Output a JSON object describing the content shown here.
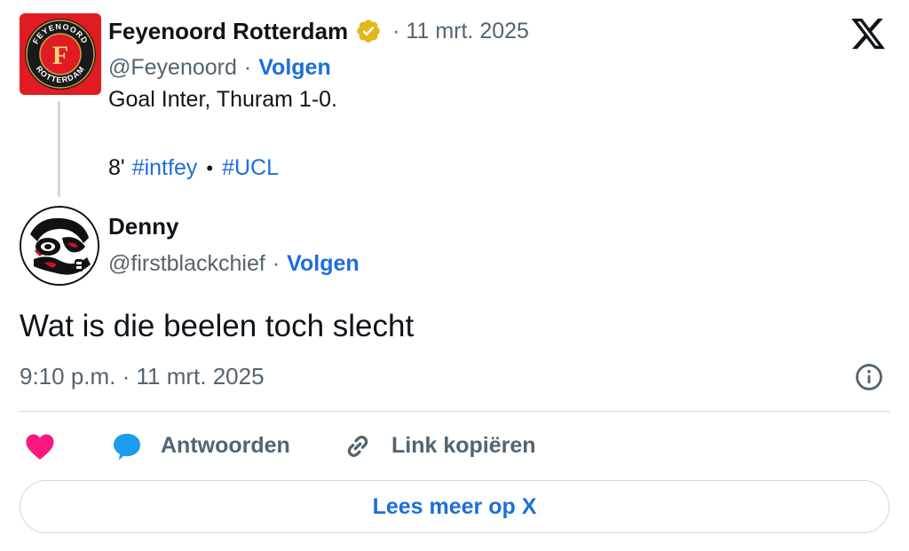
{
  "parent_tweet": {
    "author_name": "Feyenoord Rotterdam",
    "date": "· 11 mrt. 2025",
    "handle": "@Feyenoord",
    "follow_label": "Volgen",
    "text_line": "Goal Inter, Thuram 1-0.",
    "minute": "8'",
    "hashtags": [
      "#intfey",
      "#UCL"
    ],
    "avatar_text_top": "FEYENOORD",
    "avatar_text_bottom": "ROTTERDAM",
    "avatar_letter": "F"
  },
  "reply_tweet": {
    "author_name": "Denny",
    "handle": "@firstblackchief",
    "follow_label": "Volgen",
    "text": "Wat is die beelen toch slecht",
    "timestamp": "9:10 p.m. · 11 mrt. 2025"
  },
  "actions": {
    "reply_label": "Antwoorden",
    "copy_link_label": "Link kopiëren"
  },
  "footer": {
    "read_more_label": "Lees meer op X"
  },
  "colors": {
    "link_blue": "#1d6ed8",
    "muted_gray": "#536471",
    "like_pink": "#f91880",
    "reply_blue": "#1d9bf0",
    "feyenoord_red": "#e11b22",
    "verified_gold": "#e2b719"
  },
  "icons": {
    "verified": "verified-gold-badge-icon",
    "x_logo": "x-logo-icon",
    "info": "info-icon",
    "like": "heart-icon",
    "reply": "speech-bubble-icon",
    "link": "link-icon"
  }
}
